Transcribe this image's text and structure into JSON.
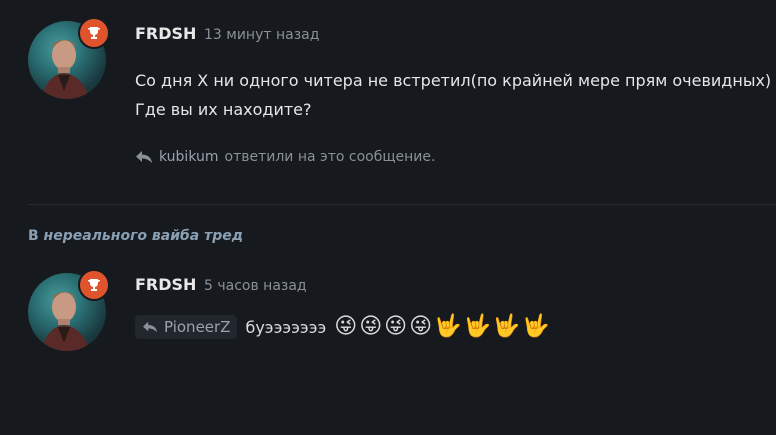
{
  "posts": [
    {
      "username": "FRDSH",
      "time": "13 минут назад",
      "lines": [
        "Со дня Х ни одного читера не встретил(по крайней мере прям очевидных)",
        "Где вы их находите?"
      ],
      "replies": {
        "user": "kubikum",
        "text": "ответили на это сообщение."
      }
    },
    {
      "username": "FRDSH",
      "time": "5 часов назад",
      "mention": "PioneerZ",
      "text": "буэээээээ",
      "emojis": [
        "😜",
        "😜",
        "😜",
        "😜",
        "🤟",
        "🤟",
        "🤟",
        "🤟"
      ]
    }
  ],
  "thread": {
    "prefix": "В ",
    "name": "нереального вайба тред"
  },
  "colors": {
    "background": "#16191e",
    "badge": "#e0542d",
    "muted": "#8a9097"
  },
  "icons": {
    "badge": "trophy-icon",
    "reply": "reply-icon"
  }
}
